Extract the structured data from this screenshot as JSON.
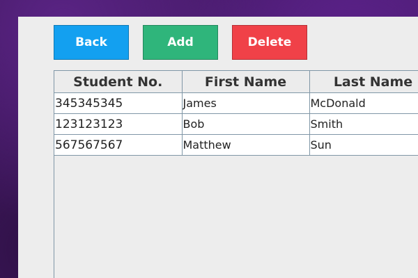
{
  "toolbar": {
    "back_label": "Back",
    "add_label": "Add",
    "delete_label": "Delete"
  },
  "colors": {
    "back": "#13a0f0",
    "add": "#2fb57b",
    "delete": "#f04148"
  },
  "table": {
    "columns": [
      "Student No.",
      "First Name",
      "Last Name"
    ],
    "rows": [
      [
        "345345345",
        "James",
        "McDonald"
      ],
      [
        "123123123",
        "Bob",
        "Smith"
      ],
      [
        "567567567",
        "Matthew",
        "Sun"
      ]
    ]
  }
}
